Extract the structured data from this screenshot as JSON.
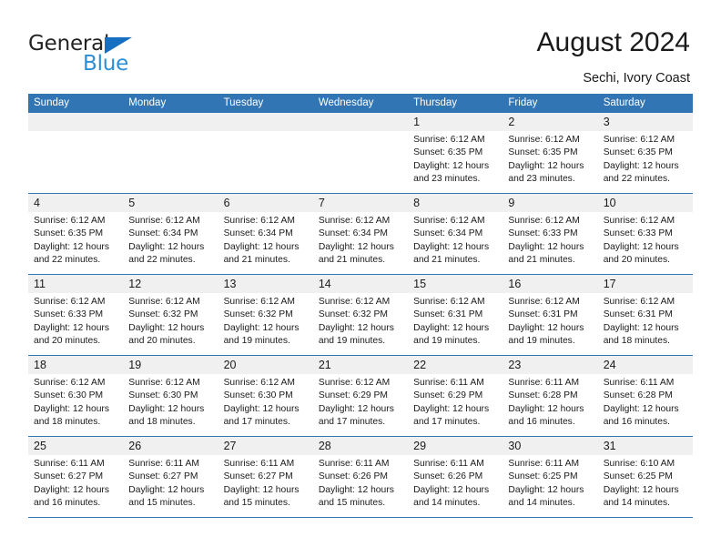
{
  "brand": {
    "name_part1": "General",
    "name_part2": "Blue",
    "triangle_color": "#176fc1",
    "blue_text_color": "#2b8fd6"
  },
  "header": {
    "title": "August 2024",
    "subtitle": "Sechi, Ivory Coast"
  },
  "calendar": {
    "header_bg": "#3175b4",
    "day_band_bg": "#f0f0f0",
    "weekdays": [
      "Sunday",
      "Monday",
      "Tuesday",
      "Wednesday",
      "Thursday",
      "Friday",
      "Saturday"
    ],
    "weeks": [
      [
        {
          "num": "",
          "lines": []
        },
        {
          "num": "",
          "lines": []
        },
        {
          "num": "",
          "lines": []
        },
        {
          "num": "",
          "lines": []
        },
        {
          "num": "1",
          "lines": [
            "Sunrise: 6:12 AM",
            "Sunset: 6:35 PM",
            "Daylight: 12 hours",
            "and 23 minutes."
          ]
        },
        {
          "num": "2",
          "lines": [
            "Sunrise: 6:12 AM",
            "Sunset: 6:35 PM",
            "Daylight: 12 hours",
            "and 23 minutes."
          ]
        },
        {
          "num": "3",
          "lines": [
            "Sunrise: 6:12 AM",
            "Sunset: 6:35 PM",
            "Daylight: 12 hours",
            "and 22 minutes."
          ]
        }
      ],
      [
        {
          "num": "4",
          "lines": [
            "Sunrise: 6:12 AM",
            "Sunset: 6:35 PM",
            "Daylight: 12 hours",
            "and 22 minutes."
          ]
        },
        {
          "num": "5",
          "lines": [
            "Sunrise: 6:12 AM",
            "Sunset: 6:34 PM",
            "Daylight: 12 hours",
            "and 22 minutes."
          ]
        },
        {
          "num": "6",
          "lines": [
            "Sunrise: 6:12 AM",
            "Sunset: 6:34 PM",
            "Daylight: 12 hours",
            "and 21 minutes."
          ]
        },
        {
          "num": "7",
          "lines": [
            "Sunrise: 6:12 AM",
            "Sunset: 6:34 PM",
            "Daylight: 12 hours",
            "and 21 minutes."
          ]
        },
        {
          "num": "8",
          "lines": [
            "Sunrise: 6:12 AM",
            "Sunset: 6:34 PM",
            "Daylight: 12 hours",
            "and 21 minutes."
          ]
        },
        {
          "num": "9",
          "lines": [
            "Sunrise: 6:12 AM",
            "Sunset: 6:33 PM",
            "Daylight: 12 hours",
            "and 21 minutes."
          ]
        },
        {
          "num": "10",
          "lines": [
            "Sunrise: 6:12 AM",
            "Sunset: 6:33 PM",
            "Daylight: 12 hours",
            "and 20 minutes."
          ]
        }
      ],
      [
        {
          "num": "11",
          "lines": [
            "Sunrise: 6:12 AM",
            "Sunset: 6:33 PM",
            "Daylight: 12 hours",
            "and 20 minutes."
          ]
        },
        {
          "num": "12",
          "lines": [
            "Sunrise: 6:12 AM",
            "Sunset: 6:32 PM",
            "Daylight: 12 hours",
            "and 20 minutes."
          ]
        },
        {
          "num": "13",
          "lines": [
            "Sunrise: 6:12 AM",
            "Sunset: 6:32 PM",
            "Daylight: 12 hours",
            "and 19 minutes."
          ]
        },
        {
          "num": "14",
          "lines": [
            "Sunrise: 6:12 AM",
            "Sunset: 6:32 PM",
            "Daylight: 12 hours",
            "and 19 minutes."
          ]
        },
        {
          "num": "15",
          "lines": [
            "Sunrise: 6:12 AM",
            "Sunset: 6:31 PM",
            "Daylight: 12 hours",
            "and 19 minutes."
          ]
        },
        {
          "num": "16",
          "lines": [
            "Sunrise: 6:12 AM",
            "Sunset: 6:31 PM",
            "Daylight: 12 hours",
            "and 19 minutes."
          ]
        },
        {
          "num": "17",
          "lines": [
            "Sunrise: 6:12 AM",
            "Sunset: 6:31 PM",
            "Daylight: 12 hours",
            "and 18 minutes."
          ]
        }
      ],
      [
        {
          "num": "18",
          "lines": [
            "Sunrise: 6:12 AM",
            "Sunset: 6:30 PM",
            "Daylight: 12 hours",
            "and 18 minutes."
          ]
        },
        {
          "num": "19",
          "lines": [
            "Sunrise: 6:12 AM",
            "Sunset: 6:30 PM",
            "Daylight: 12 hours",
            "and 18 minutes."
          ]
        },
        {
          "num": "20",
          "lines": [
            "Sunrise: 6:12 AM",
            "Sunset: 6:30 PM",
            "Daylight: 12 hours",
            "and 17 minutes."
          ]
        },
        {
          "num": "21",
          "lines": [
            "Sunrise: 6:12 AM",
            "Sunset: 6:29 PM",
            "Daylight: 12 hours",
            "and 17 minutes."
          ]
        },
        {
          "num": "22",
          "lines": [
            "Sunrise: 6:11 AM",
            "Sunset: 6:29 PM",
            "Daylight: 12 hours",
            "and 17 minutes."
          ]
        },
        {
          "num": "23",
          "lines": [
            "Sunrise: 6:11 AM",
            "Sunset: 6:28 PM",
            "Daylight: 12 hours",
            "and 16 minutes."
          ]
        },
        {
          "num": "24",
          "lines": [
            "Sunrise: 6:11 AM",
            "Sunset: 6:28 PM",
            "Daylight: 12 hours",
            "and 16 minutes."
          ]
        }
      ],
      [
        {
          "num": "25",
          "lines": [
            "Sunrise: 6:11 AM",
            "Sunset: 6:27 PM",
            "Daylight: 12 hours",
            "and 16 minutes."
          ]
        },
        {
          "num": "26",
          "lines": [
            "Sunrise: 6:11 AM",
            "Sunset: 6:27 PM",
            "Daylight: 12 hours",
            "and 15 minutes."
          ]
        },
        {
          "num": "27",
          "lines": [
            "Sunrise: 6:11 AM",
            "Sunset: 6:27 PM",
            "Daylight: 12 hours",
            "and 15 minutes."
          ]
        },
        {
          "num": "28",
          "lines": [
            "Sunrise: 6:11 AM",
            "Sunset: 6:26 PM",
            "Daylight: 12 hours",
            "and 15 minutes."
          ]
        },
        {
          "num": "29",
          "lines": [
            "Sunrise: 6:11 AM",
            "Sunset: 6:26 PM",
            "Daylight: 12 hours",
            "and 14 minutes."
          ]
        },
        {
          "num": "30",
          "lines": [
            "Sunrise: 6:11 AM",
            "Sunset: 6:25 PM",
            "Daylight: 12 hours",
            "and 14 minutes."
          ]
        },
        {
          "num": "31",
          "lines": [
            "Sunrise: 6:10 AM",
            "Sunset: 6:25 PM",
            "Daylight: 12 hours",
            "and 14 minutes."
          ]
        }
      ]
    ]
  }
}
